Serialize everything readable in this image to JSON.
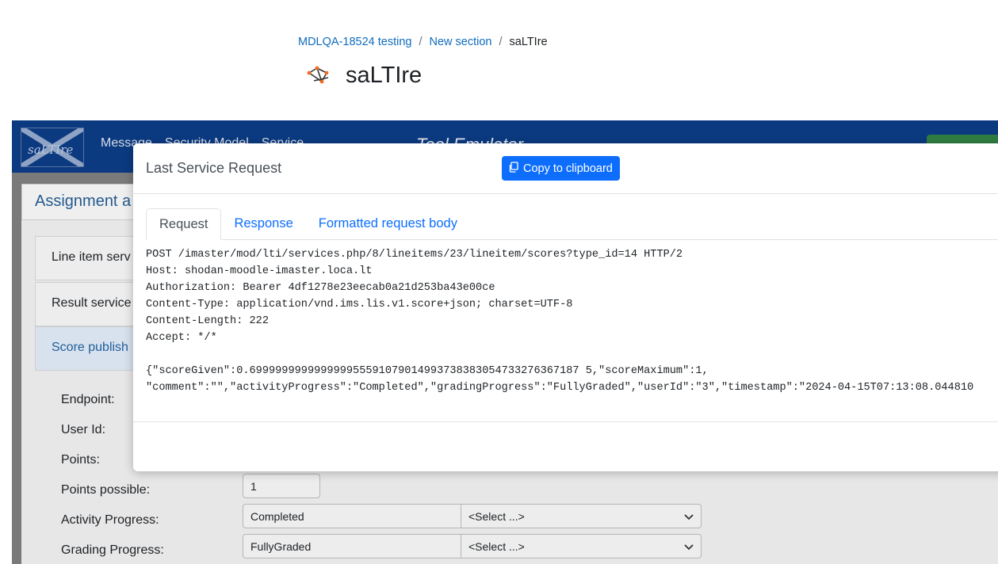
{
  "breadcrumb": {
    "items": [
      "MDLQA-18524 testing",
      "New section"
    ],
    "current": "saLTIre"
  },
  "page": {
    "title": "saLTIre"
  },
  "tool": {
    "logo_text": "saLTIre",
    "nav": [
      "Message",
      "Security Model",
      "Service"
    ],
    "title": "Tool Emulator",
    "card_title": "Assignment a",
    "accordion": [
      "Line item serv",
      "Result service",
      "Score publish"
    ],
    "form": {
      "endpoint_label": "Endpoint:",
      "user_id_label": "User Id:",
      "points_label": "Points:",
      "points_possible_label": "Points possible:",
      "points_possible_value": "1",
      "activity_progress_label": "Activity Progress:",
      "activity_progress_value": "Completed",
      "activity_select": "<Select ...>",
      "grading_progress_label": "Grading Progress:",
      "grading_progress_value": "FullyGraded",
      "grading_select": "<Select ...>"
    }
  },
  "modal": {
    "title": "Last Service Request",
    "copy_button": "Copy to clipboard",
    "tabs": [
      "Request",
      "Response",
      "Formatted request body"
    ],
    "active_tab": "Request",
    "request_lines": [
      "POST /imaster/mod/lti/services.php/8/lineitems/23/lineitem/scores?type_id=14 HTTP/2",
      "Host: shodan-moodle-imaster.loca.lt",
      "Authorization: Bearer 4df1278e23eecab0a21d253ba43e00ce",
      "Content-Type: application/vnd.ims.lis.v1.score+json; charset=UTF-8",
      "Content-Length: 222",
      "Accept: */*",
      "",
      "{\"scoreGiven\":0.699999999999999955591079014993738383054733276367187 5,\"scoreMaximum\":1,",
      "\"comment\":\"\",\"activityProgress\":\"Completed\",\"gradingProgress\":\"FullyGraded\",\"userId\":\"3\",\"timestamp\":\"2024-04-15T07:13:08.044810"
    ]
  },
  "colors": {
    "primary": "#0d6efd",
    "link": "#0f6cbf",
    "navbar": "#0b3a80",
    "overlay": "#7a7a7a"
  }
}
